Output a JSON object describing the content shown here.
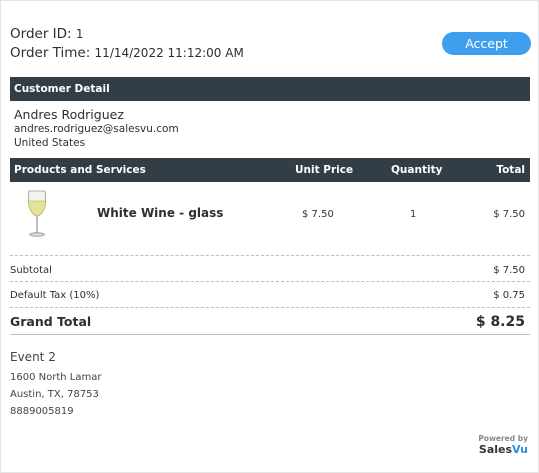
{
  "order": {
    "id_label": "Order ID:",
    "id_value": "1",
    "time_label": "Order Time:",
    "time_value": "11/14/2022 11:12:00 AM"
  },
  "accept_label": "Accept",
  "customer_section": {
    "title": "Customer Detail",
    "name": "Andres Rodriguez",
    "email": "andres.rodriguez@salesvu.com",
    "country": "United States"
  },
  "products_section": {
    "headers": {
      "product": "Products and Services",
      "unit_price": "Unit Price",
      "quantity": "Quantity",
      "total": "Total"
    },
    "items": [
      {
        "name": "White Wine - glass",
        "unit_price": "$ 7.50",
        "quantity": "1",
        "total": "$ 7.50",
        "icon": "wine-glass-icon"
      }
    ]
  },
  "summary": {
    "subtotal_label": "Subtotal",
    "subtotal_value": "$ 7.50",
    "tax_label": "Default Tax (10%)",
    "tax_value": "$ 0.75",
    "grand_label": "Grand Total",
    "grand_value": "$ 8.25"
  },
  "event": {
    "name": "Event 2",
    "address1": "1600 North Lamar",
    "address2": "Austin, TX, 78753",
    "phone": "8889005819"
  },
  "branding": {
    "powered_by": "Powered by",
    "brand_sales": "Sales",
    "brand_vu": "Vu"
  },
  "colors": {
    "accent": "#3f9fee",
    "header_bar": "#333d45"
  }
}
